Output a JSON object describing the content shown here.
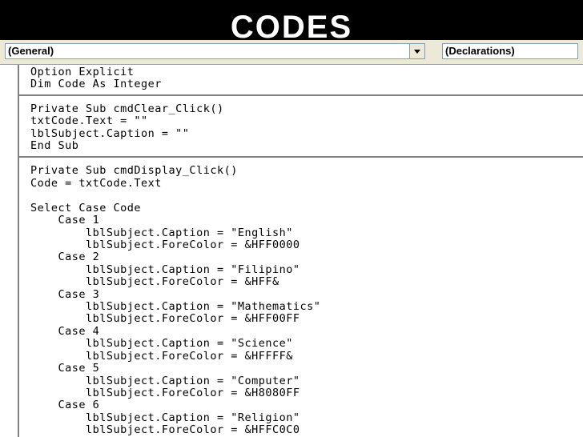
{
  "title": "CODES",
  "object_combo": {
    "value": "(General)"
  },
  "procedure_combo": {
    "value": "(Declarations)"
  },
  "code_lines": [
    "Option Explicit",
    "Dim Code As Integer",
    "Private Sub cmdClear_Click()",
    "txtCode.Text = \"\"",
    "lblSubject.Caption = \"\"",
    "End Sub",
    "Private Sub cmdDisplay_Click()",
    "Code = txtCode.Text",
    "Select Case Code",
    "    Case 1",
    "        lblSubject.Caption = \"English\"",
    "        lblSubject.ForeColor = &HFF0000",
    "    Case 2",
    "        lblSubject.Caption = \"Filipino\"",
    "        lblSubject.ForeColor = &HFF&",
    "    Case 3",
    "        lblSubject.Caption = \"Mathematics\"",
    "        lblSubject.ForeColor = &HFF00FF",
    "    Case 4",
    "        lblSubject.Caption = \"Science\"",
    "        lblSubject.ForeColor = &HFFFF&",
    "    Case 5",
    "        lblSubject.Caption = \"Computer\"",
    "        lblSubject.ForeColor = &H8080FF",
    "    Case 6",
    "        lblSubject.Caption = \"Religion\"",
    "        lblSubject.ForeColor = &HFFC0C0"
  ]
}
